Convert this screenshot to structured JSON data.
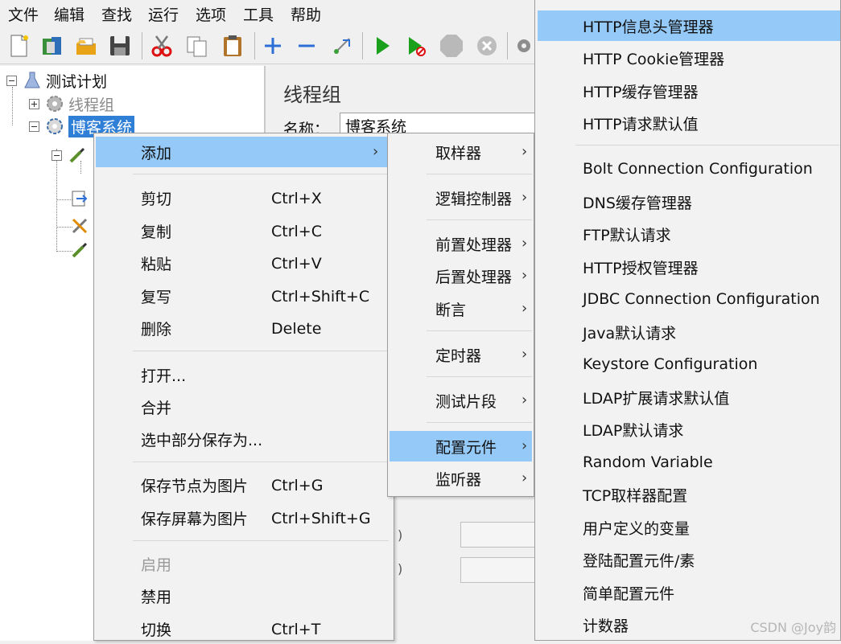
{
  "menubar": {
    "items": [
      "文件",
      "编辑",
      "查找",
      "运行",
      "选项",
      "工具",
      "帮助"
    ]
  },
  "toolbar": {
    "buttons": [
      "new-icon",
      "templates-icon",
      "open-icon",
      "save-icon",
      "cut-icon",
      "copy-icon",
      "paste-icon",
      "expand-icon",
      "collapse-icon",
      "toggle-icon",
      "start-icon",
      "start-no-pause-icon",
      "stop-icon",
      "shutdown-icon",
      "settings-icon"
    ]
  },
  "tree": {
    "root": "测试计划",
    "nodes": [
      {
        "label": "线程组",
        "state": "disabled"
      },
      {
        "label": "博客系统",
        "state": "selected"
      }
    ]
  },
  "content": {
    "title": "线程组",
    "name_label": "名称：",
    "name_value": "博客系统"
  },
  "context_menu": {
    "add": "添加",
    "groups": [
      [
        {
          "label": "剪切",
          "shortcut": "Ctrl+X"
        },
        {
          "label": "复制",
          "shortcut": "Ctrl+C"
        },
        {
          "label": "粘贴",
          "shortcut": "Ctrl+V"
        },
        {
          "label": "复写",
          "shortcut": "Ctrl+Shift+C"
        },
        {
          "label": "删除",
          "shortcut": "Delete"
        }
      ],
      [
        {
          "label": "打开...",
          "shortcut": ""
        },
        {
          "label": "合并",
          "shortcut": ""
        },
        {
          "label": "选中部分保存为...",
          "shortcut": ""
        }
      ],
      [
        {
          "label": "保存节点为图片",
          "shortcut": "Ctrl+G"
        },
        {
          "label": "保存屏幕为图片",
          "shortcut": "Ctrl+Shift+G"
        }
      ],
      [
        {
          "label": "启用",
          "shortcut": "",
          "disabled": true
        },
        {
          "label": "禁用",
          "shortcut": ""
        },
        {
          "label": "切换",
          "shortcut": "Ctrl+T"
        }
      ]
    ]
  },
  "add_submenu": {
    "items": [
      "取样器",
      "逻辑控制器",
      "前置处理器",
      "后置处理器",
      "断言",
      "定时器",
      "测试片段",
      "配置元件",
      "监听器"
    ],
    "highlighted": "配置元件"
  },
  "config_submenu": {
    "items": [
      "HTTP信息头管理器",
      "HTTP Cookie管理器",
      "HTTP缓存管理器",
      "HTTP请求默认值",
      "Bolt Connection Configuration",
      "DNS缓存管理器",
      "FTP默认请求",
      "HTTP授权管理器",
      "JDBC Connection Configuration",
      "Java默认请求",
      "Keystore Configuration",
      "LDAP扩展请求默认值",
      "LDAP默认请求",
      "Random Variable",
      "TCP取样器配置",
      "用户定义的变量",
      "登陆配置元件/素",
      "简单配置元件",
      "计数器"
    ],
    "highlighted": "HTTP信息头管理器"
  },
  "watermark": "CSDN @Joy韵",
  "colors": {
    "highlight": "#94c9f8",
    "selection": "#2f7fd6",
    "menu_bg": "#f2f2f2",
    "run_green": "#1aa01a"
  }
}
